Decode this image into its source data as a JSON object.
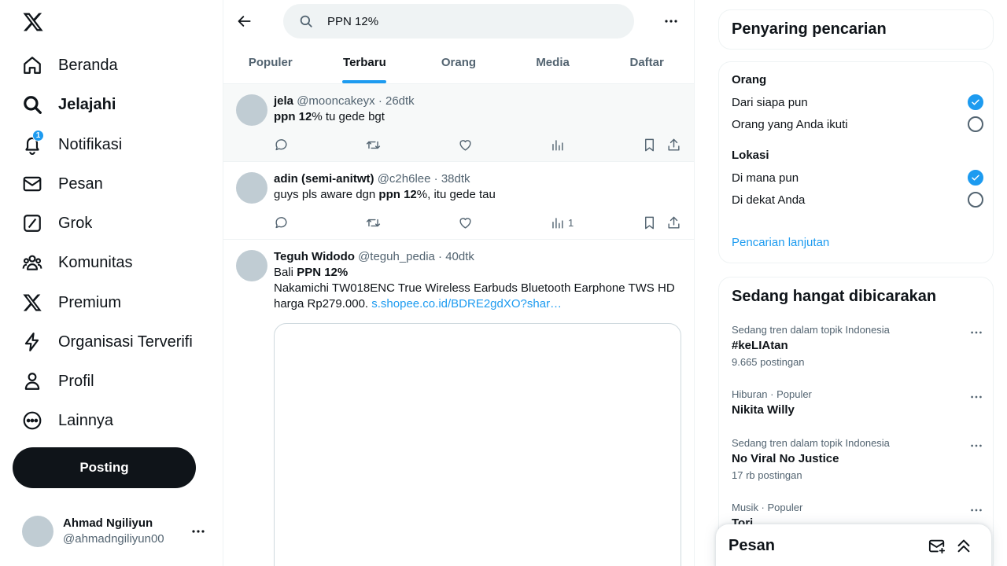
{
  "sidebar": {
    "logo": "x-logo-icon",
    "items": [
      {
        "label": "Beranda",
        "icon": "home-icon"
      },
      {
        "label": "Jelajahi",
        "icon": "search-icon",
        "active": true
      },
      {
        "label": "Notifikasi",
        "icon": "bell-icon",
        "badge": "1"
      },
      {
        "label": "Pesan",
        "icon": "envelope-icon"
      },
      {
        "label": "Grok",
        "icon": "grok-icon"
      },
      {
        "label": "Komunitas",
        "icon": "people-icon"
      },
      {
        "label": "Premium",
        "icon": "x-logo-icon"
      },
      {
        "label": "Organisasi Terverifi",
        "icon": "lightning-icon"
      },
      {
        "label": "Profil",
        "icon": "person-icon"
      },
      {
        "label": "Lainnya",
        "icon": "more-circle-icon"
      }
    ],
    "post_label": "Posting",
    "account": {
      "name": "Ahmad Ngiliyun",
      "handle": "@ahmadngiliyun00"
    }
  },
  "search": {
    "query": "PPN 12%"
  },
  "tabs": [
    "Populer",
    "Terbaru",
    "Orang",
    "Media",
    "Daftar"
  ],
  "active_tab": "Terbaru",
  "tweets": [
    {
      "name": "jela",
      "handle": "@mooncakeyx",
      "time": "26dtk",
      "text_parts": [
        {
          "b": "ppn 12"
        },
        {
          "t": "% tu gede bgt"
        }
      ],
      "views": ""
    },
    {
      "name": "adin (semi-anitwt)",
      "handle": "@c2h6lee",
      "time": "38dtk",
      "text_parts": [
        {
          "t": "guys pls aware dgn "
        },
        {
          "b": "ppn 12"
        },
        {
          "t": "%, itu gede tau"
        }
      ],
      "views": "1"
    },
    {
      "name": "Teguh Widodo",
      "handle": "@teguh_pedia",
      "time": "40dtk",
      "line1": "Bali ",
      "line1_bold": "PPN 12",
      "line1_tail": "%",
      "line2": "Nakamichi TW018ENC True Wireless Earbuds Bluetooth Earphone TWS HD",
      "line3": "harga Rp279.000. ",
      "link": "s.shopee.co.id/BDRE2gdXO?shar…"
    }
  ],
  "filters": {
    "title": "Penyaring pencarian",
    "people_title": "Orang",
    "people_options": [
      {
        "label": "Dari siapa pun",
        "checked": true
      },
      {
        "label": "Orang yang Anda ikuti",
        "checked": false
      }
    ],
    "location_title": "Lokasi",
    "location_options": [
      {
        "label": "Di mana pun",
        "checked": true
      },
      {
        "label": "Di dekat Anda",
        "checked": false
      }
    ],
    "advanced": "Pencarian lanjutan"
  },
  "trends": {
    "title": "Sedang hangat dibicarakan",
    "items": [
      {
        "category": "Sedang tren dalam topik Indonesia",
        "name": "#keLIAtan",
        "count": "9.665 postingan"
      },
      {
        "category": "Hiburan · Populer",
        "name": "Nikita Willy",
        "count": ""
      },
      {
        "category": "Sedang tren dalam topik Indonesia",
        "name": "No Viral No Justice",
        "count": "17 rb postingan"
      },
      {
        "category": "Musik · Populer",
        "name": "Tori",
        "count": ""
      }
    ]
  },
  "dm": {
    "title": "Pesan"
  },
  "colors": {
    "accent": "#1d9bf0",
    "text": "#0f1419",
    "muted": "#536471"
  }
}
